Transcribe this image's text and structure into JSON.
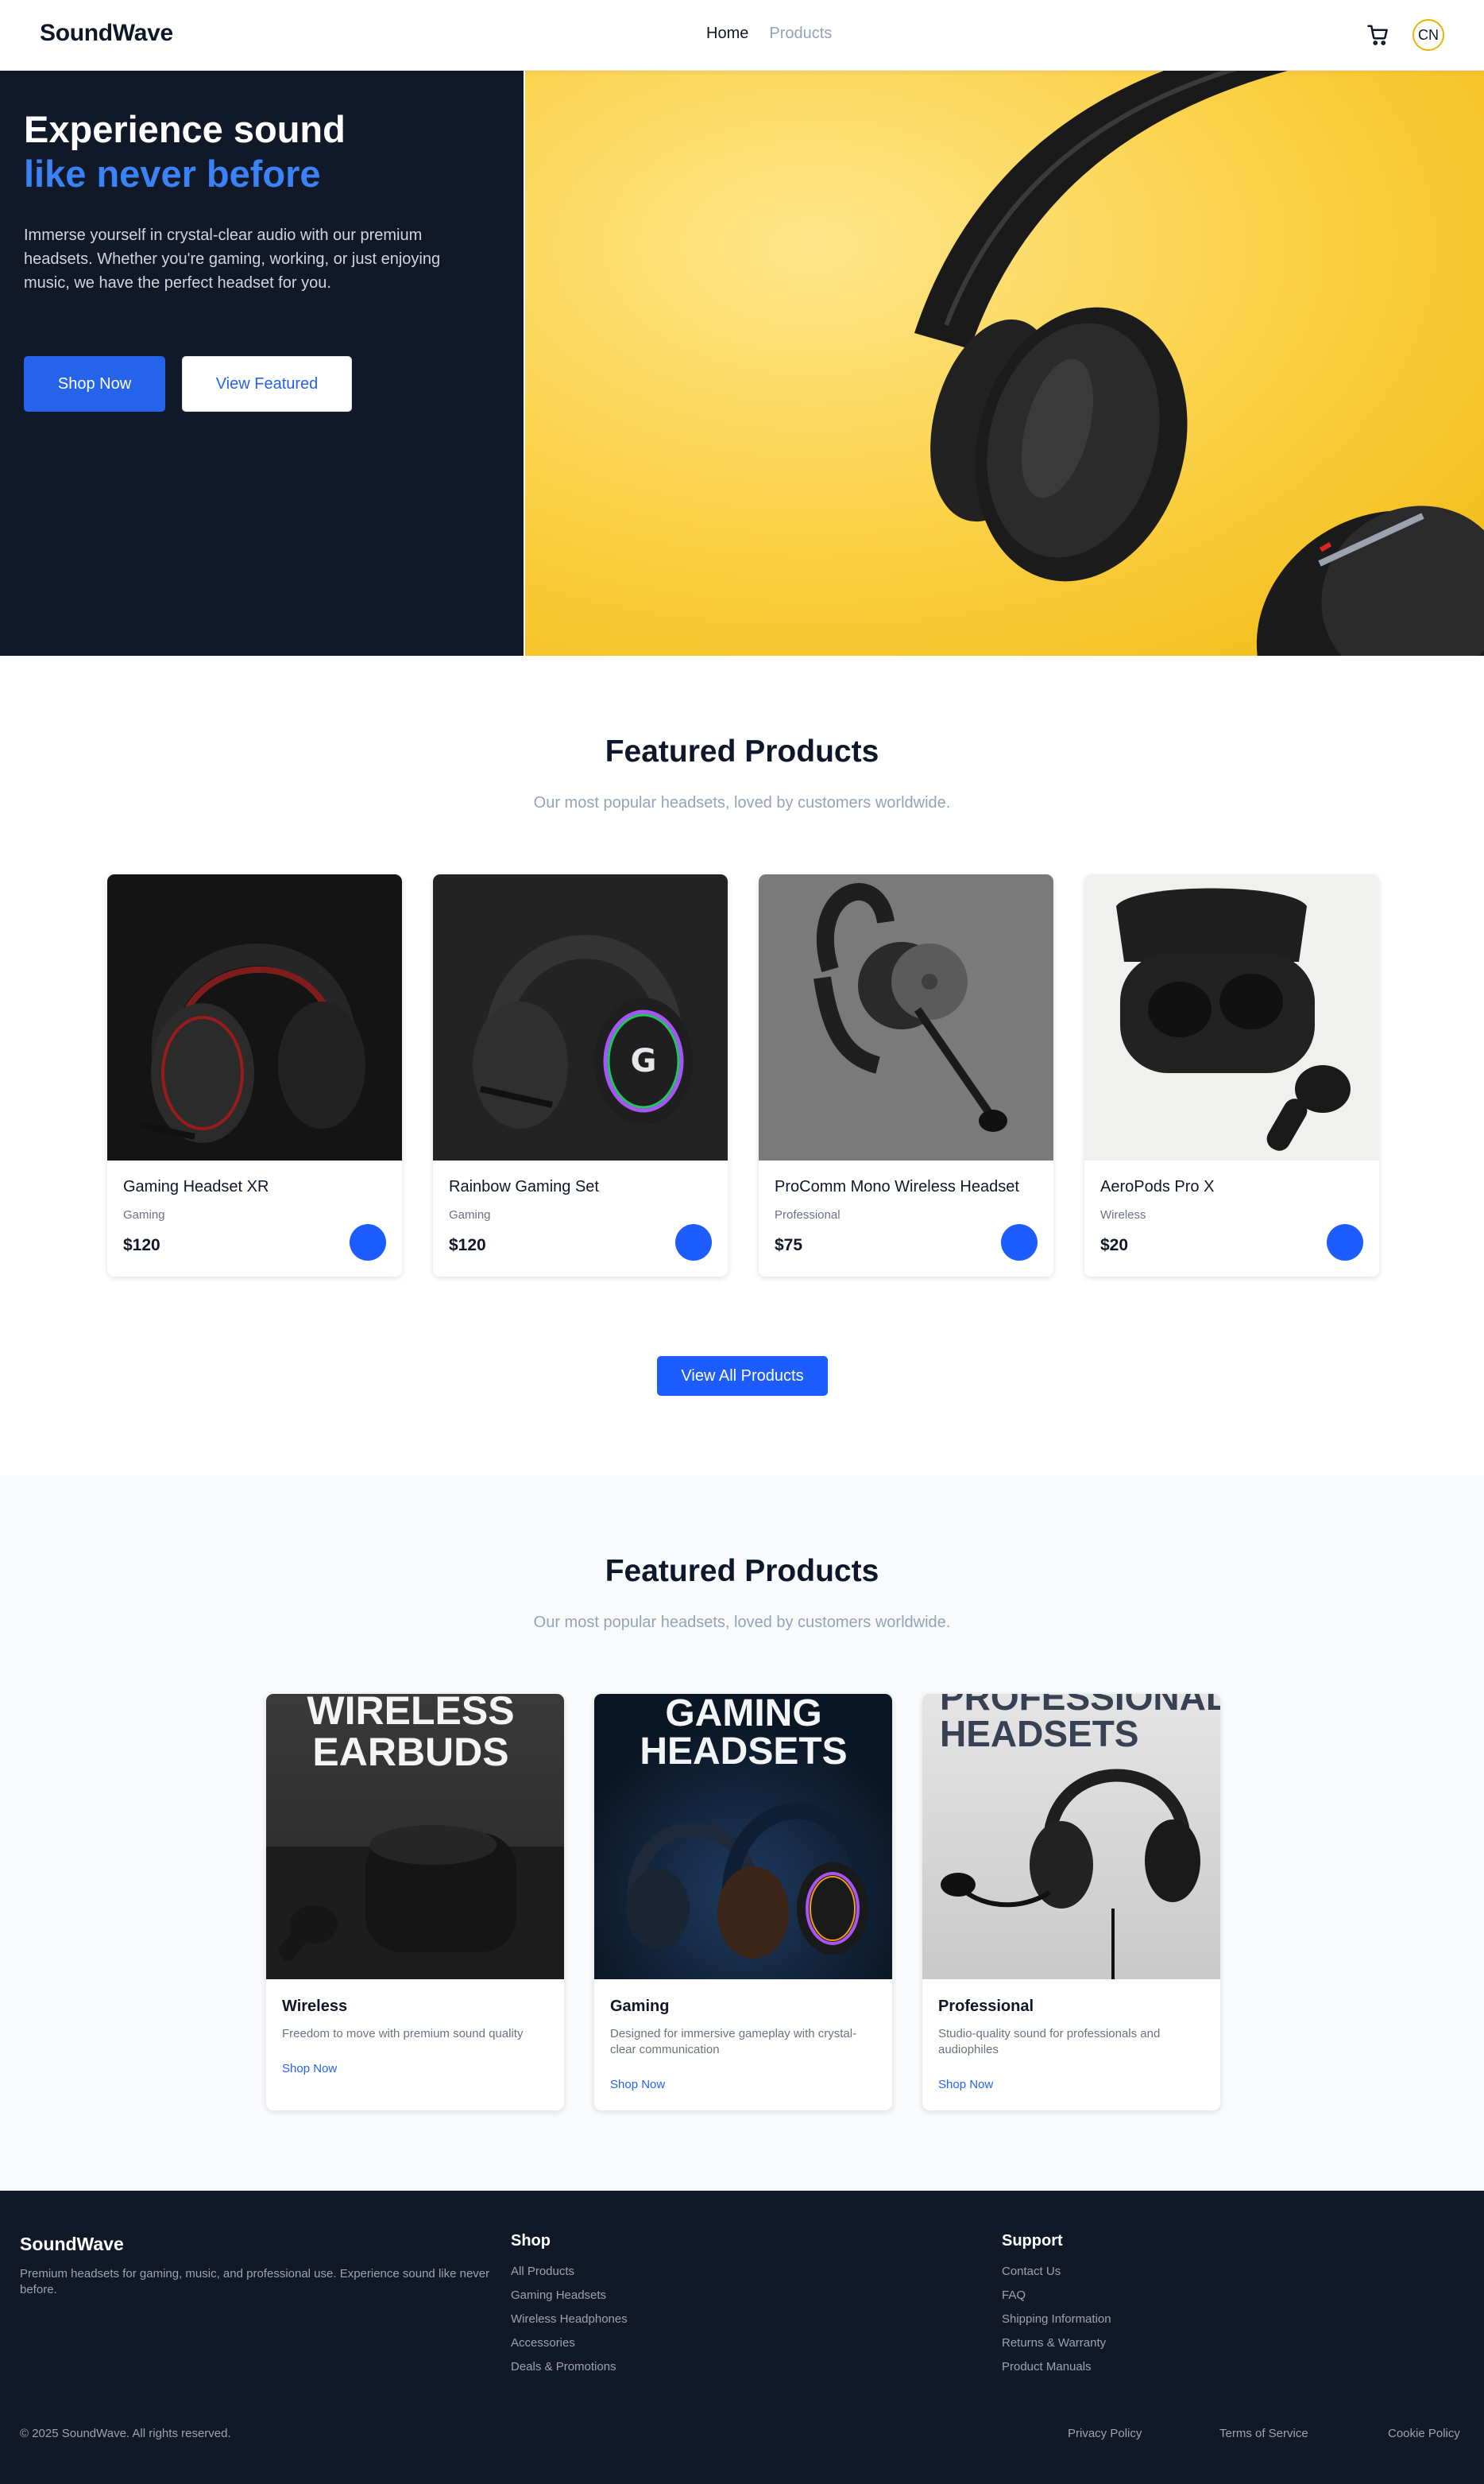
{
  "header": {
    "logo": "SoundWave",
    "nav": [
      {
        "label": "Home",
        "active": true
      },
      {
        "label": "Products",
        "active": false
      }
    ],
    "cart_icon": "cart-icon",
    "avatar_initials": "CN"
  },
  "hero": {
    "title_line1": "Experience sound",
    "title_line2": "like never before",
    "text": "Immerse yourself in crystal-clear audio with our premium headsets. Whether you're gaming, working, or just enjoying music, we have the perfect headset for you.",
    "primary_button": "Shop Now",
    "secondary_button": "View Featured"
  },
  "featured": {
    "title": "Featured Products",
    "subtitle": "Our most popular headsets, loved by customers worldwide.",
    "products": [
      {
        "name": "Gaming Headset XR",
        "category": "Gaming",
        "price": "$120"
      },
      {
        "name": "Rainbow Gaming Set",
        "category": "Gaming",
        "price": "$120"
      },
      {
        "name": "ProComm Mono Wireless Headset",
        "category": "Professional",
        "price": "$75"
      },
      {
        "name": "AeroPods Pro X",
        "category": "Wireless",
        "price": "$20"
      }
    ],
    "view_all_button": "View All Products"
  },
  "categories": {
    "title": "Featured Products",
    "subtitle": "Our most popular headsets, loved by customers worldwide.",
    "items": [
      {
        "image_title_1": "WIRELESS",
        "image_title_2": "EARBUDS",
        "name": "Wireless",
        "description": "Freedom to move with premium sound quality",
        "link": "Shop Now"
      },
      {
        "image_title_1": "GAMING",
        "image_title_2": "HEADSETS",
        "name": "Gaming",
        "description": "Designed for immersive gameplay with crystal-clear communication",
        "link": "Shop Now"
      },
      {
        "image_title_1": "PROFESSIONAL",
        "image_title_2": "HEADSETS",
        "name": "Professional",
        "description": "Studio-quality sound for professionals and audiophiles",
        "link": "Shop Now"
      }
    ]
  },
  "footer": {
    "brand": "SoundWave",
    "about": "Premium headsets for gaming, music, and professional use. Experience sound like never before.",
    "shop_title": "Shop",
    "shop_links": [
      "All Products",
      "Gaming Headsets",
      "Wireless Headphones",
      "Accessories",
      "Deals & Promotions"
    ],
    "support_title": "Support",
    "support_links": [
      "Contact Us",
      "FAQ",
      "Shipping Information",
      "Returns & Warranty",
      "Product Manuals"
    ],
    "copyright": "© 2025 SoundWave. All rights reserved.",
    "legal_links": [
      "Privacy Policy",
      "Terms of Service",
      "Cookie Policy"
    ]
  },
  "colors": {
    "accent": "#2563eb",
    "dark": "#111827",
    "hero_yellow": "#fcd34d"
  }
}
